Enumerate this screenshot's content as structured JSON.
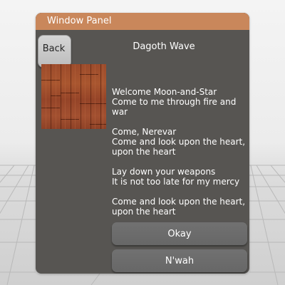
{
  "window": {
    "title": "Window Panel"
  },
  "back_button": {
    "label": "Back"
  },
  "header": {
    "text": "Dagoth Wave"
  },
  "image": {
    "icon": "wood-plank-texture-icon"
  },
  "lyrics": {
    "paragraphs": [
      {
        "lines": [
          "Welcome Moon-and-Star",
          "Come to me through fire and war"
        ]
      },
      {
        "lines": [
          "Come, Nerevar",
          "Come and look upon the heart, upon the heart"
        ]
      },
      {
        "lines": [
          "Lay down your weapons",
          "It is not too late for my mercy"
        ]
      },
      {
        "lines": [
          "Come and look upon the heart, upon the heart"
        ]
      }
    ]
  },
  "buttons": {
    "okay": "Okay",
    "nwah": "N'wah"
  },
  "colors": {
    "titlebar": "#c9875b",
    "panel": "#575552",
    "button": "#6c6c6c"
  }
}
